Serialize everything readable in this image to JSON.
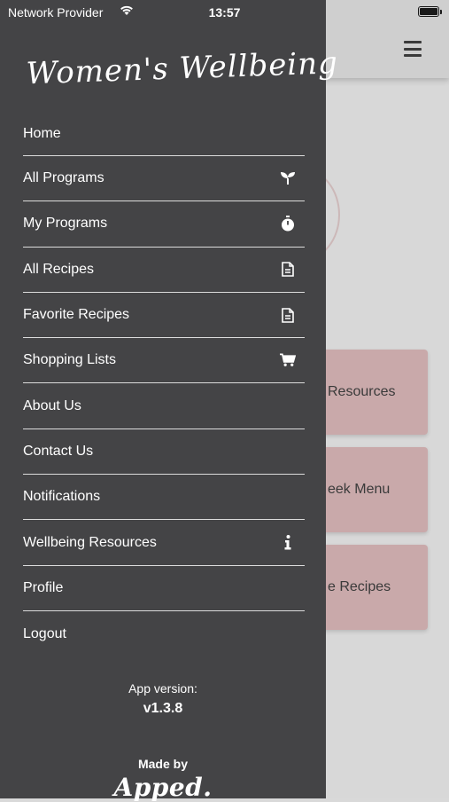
{
  "status_bar": {
    "carrier": "Network Provider",
    "time": "13:57",
    "battery_level": 1.0
  },
  "background": {
    "cards": [
      {
        "label": "Resources"
      },
      {
        "label": "eek Menu"
      },
      {
        "label": "e Recipes"
      }
    ]
  },
  "drawer": {
    "logo_text": "Women's Wellbeing",
    "menu": [
      {
        "label": "Home",
        "icon": ""
      },
      {
        "label": "All Programs",
        "icon": "sprout-icon"
      },
      {
        "label": "My Programs",
        "icon": "stopwatch-icon"
      },
      {
        "label": "All Recipes",
        "icon": "document-icon"
      },
      {
        "label": "Favorite Recipes",
        "icon": "document-icon"
      },
      {
        "label": "Shopping Lists",
        "icon": "cart-icon"
      },
      {
        "label": "About Us",
        "icon": ""
      },
      {
        "label": "Contact Us",
        "icon": ""
      },
      {
        "label": "Notifications",
        "icon": ""
      },
      {
        "label": "Wellbeing Resources",
        "icon": "info-icon"
      },
      {
        "label": "Profile",
        "icon": ""
      },
      {
        "label": "Logout",
        "icon": ""
      }
    ],
    "app_version_label": "App version:",
    "app_version": "v1.3.8",
    "made_by_label": "Made by",
    "made_by_brand": "Apped."
  }
}
